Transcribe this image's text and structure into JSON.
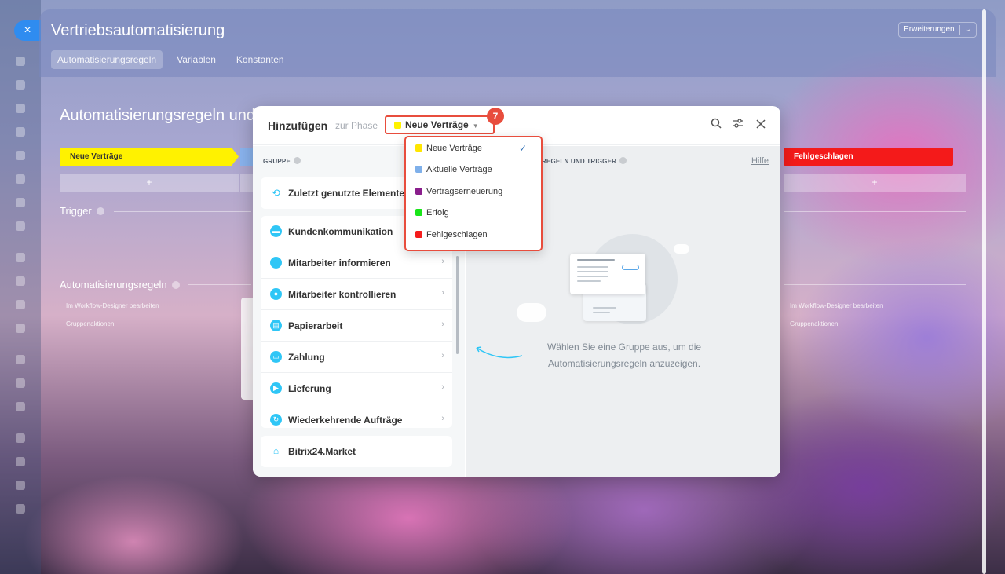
{
  "slider": {
    "close_label": "×",
    "title": "Vertriebsautomatisierung",
    "tabs": [
      {
        "label": "Automatisierungsregeln"
      },
      {
        "label": "Variablen"
      },
      {
        "label": "Konstanten"
      }
    ],
    "extensions_button": "Erweiterungen",
    "extensions_caret": "⌄"
  },
  "page": {
    "title": "Automatisierungsregeln und",
    "stages": [
      {
        "label": "Neue Verträge",
        "color": "#fff200"
      },
      {
        "label": "Fehlgeschlagen",
        "color": "#f41a1a"
      }
    ],
    "add_label": "+",
    "trigger_label": "Trigger",
    "rules_label": "Automatisierungsregeln",
    "left_links": {
      "designer": "Im Workflow-Designer bearbeiten",
      "group": "Gruppenaktionen"
    },
    "right_links": {
      "designer": "Im Workflow-Designer bearbeiten",
      "group": "Gruppenaktionen"
    }
  },
  "popup": {
    "title": "Hinzufügen",
    "subtitle": "zur Phase",
    "selected_phase": "Neue Verträge",
    "selected_color": "#fff200",
    "group_header": "GRUPPE",
    "rules_header": "GSREGELN UND TRIGGER",
    "help_link": "Hilfe",
    "recent": {
      "label": "Zuletzt genutzte Elemente",
      "icon": "history-icon"
    },
    "groups": [
      {
        "label": "Kundenkommunikation",
        "icon": "chat-icon"
      },
      {
        "label": "Mitarbeiter informieren",
        "icon": "info-icon"
      },
      {
        "label": "Mitarbeiter kontrollieren",
        "icon": "users-icon"
      },
      {
        "label": "Papierarbeit",
        "icon": "document-icon"
      },
      {
        "label": "Zahlung",
        "icon": "wallet-icon"
      },
      {
        "label": "Lieferung",
        "icon": "truck-icon"
      },
      {
        "label": "Wiederkehrende Aufträge",
        "icon": "repeat-icon"
      }
    ],
    "market": {
      "label": "Bitrix24.Market",
      "icon": "market-icon"
    },
    "empty_text_line1": "Wählen Sie eine Gruppe aus, um die",
    "empty_text_line2": "Automatisierungsregeln anzuzeigen.",
    "step_badge": "7"
  },
  "dropdown": {
    "items": [
      {
        "label": "Neue Verträge",
        "color": "#ffe600",
        "selected": true
      },
      {
        "label": "Aktuelle Verträge",
        "color": "#7fb0ea",
        "selected": false
      },
      {
        "label": "Vertragserneuerung",
        "color": "#8a1e8c",
        "selected": false
      },
      {
        "label": "Erfolg",
        "color": "#19e519",
        "selected": false
      },
      {
        "label": "Fehlgeschlagen",
        "color": "#f51c1c",
        "selected": false
      }
    ],
    "check_glyph": "✓"
  }
}
